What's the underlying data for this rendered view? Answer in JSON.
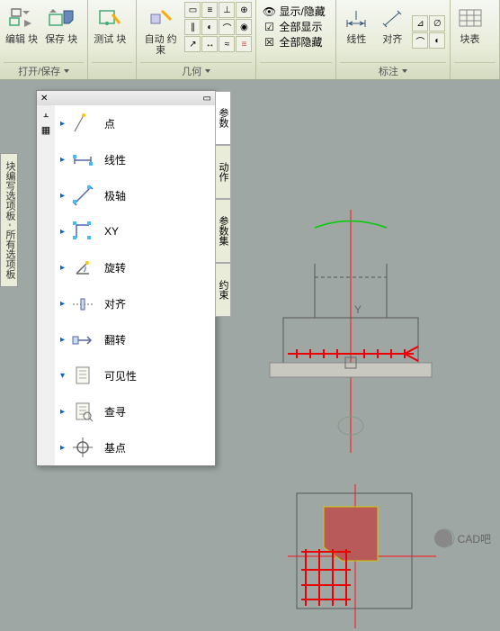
{
  "ribbon": {
    "group1": {
      "edit_block": "编辑\n块",
      "save_block": "保存\n块",
      "label": "打开/保存"
    },
    "group2": {
      "test_block": "测试\n块"
    },
    "group3": {
      "auto_constrain": "自动\n约束",
      "label": "几何"
    },
    "group4": {
      "show_hide": "显示/隐藏",
      "show_all": "全部显示",
      "hide_all": "全部隐藏"
    },
    "group5": {
      "linear": "线性",
      "align": "对齐",
      "label": "标注"
    },
    "group6": {
      "block_table": "块表"
    }
  },
  "vtab": "块编写选项板 - 所有选项板",
  "palette": {
    "items": [
      {
        "label": "点"
      },
      {
        "label": "线性"
      },
      {
        "label": "极轴"
      },
      {
        "label": "XY"
      },
      {
        "label": "旋转"
      },
      {
        "label": "对齐"
      },
      {
        "label": "翻转"
      },
      {
        "label": "可见性"
      },
      {
        "label": "查寻"
      },
      {
        "label": "基点"
      }
    ],
    "tabs": [
      "参数",
      "动作",
      "参数集",
      "约束"
    ]
  },
  "watermark": "CAD吧"
}
